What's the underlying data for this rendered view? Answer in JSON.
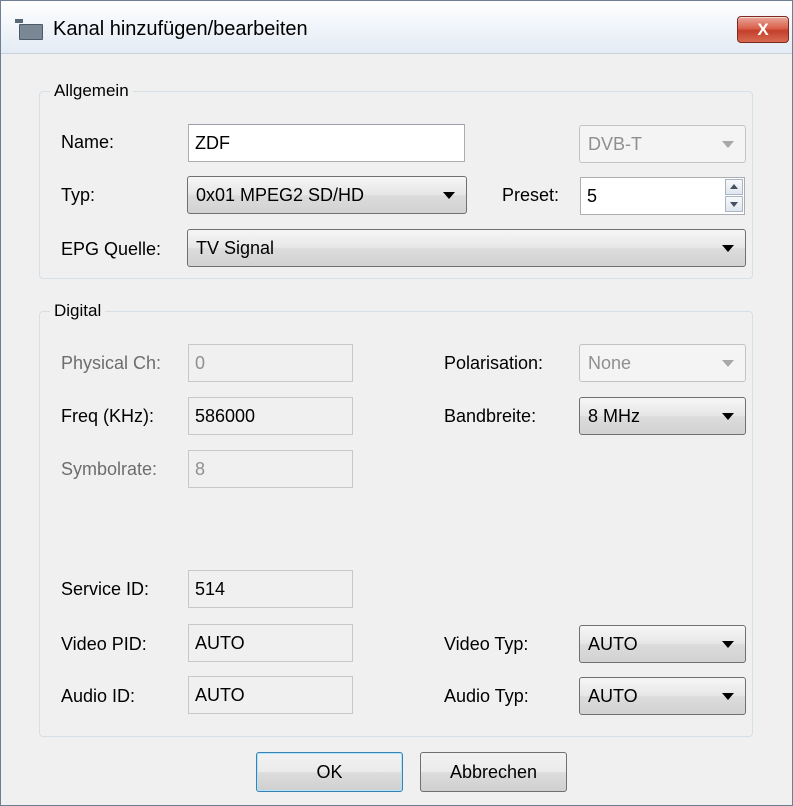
{
  "window": {
    "title": "Kanal hinzufügen/bearbeiten",
    "close_label": "X"
  },
  "allgemein": {
    "legend": "Allgemein",
    "name_label": "Name:",
    "name_value": "ZDF",
    "source_select": "DVB-T",
    "typ_label": "Typ:",
    "typ_select": "0x01 MPEG2 SD/HD",
    "preset_label": "Preset:",
    "preset_value": "5",
    "epg_label": "EPG Quelle:",
    "epg_select": "TV Signal"
  },
  "digital": {
    "legend": "Digital",
    "physical_label": "Physical Ch:",
    "physical_value": "0",
    "freq_label": "Freq (KHz):",
    "freq_value": "586000",
    "symbol_label": "Symbolrate:",
    "symbol_value": "8",
    "polarisation_label": "Polarisation:",
    "polarisation_select": "None",
    "bandbreite_label": "Bandbreite:",
    "bandbreite_select": "8 MHz",
    "service_label": "Service ID:",
    "service_value": "514",
    "video_pid_label": "Video PID:",
    "video_pid_value": "AUTO",
    "audio_id_label": "Audio ID:",
    "audio_id_value": "AUTO",
    "video_typ_label": "Video Typ:",
    "video_typ_select": "AUTO",
    "audio_typ_label": "Audio Typ:",
    "audio_typ_select": "AUTO"
  },
  "buttons": {
    "ok": "OK",
    "cancel": "Abbrechen"
  },
  "icons": {
    "app": "tv-tuner-icon",
    "close": "close-icon",
    "dropdown": "chevron-down-icon",
    "spin": "spinner-arrows-icon"
  },
  "colors": {
    "close_button": "#c4402a",
    "default_button_border": "#3c7fb1",
    "disabled_text": "#8f8f8f"
  }
}
